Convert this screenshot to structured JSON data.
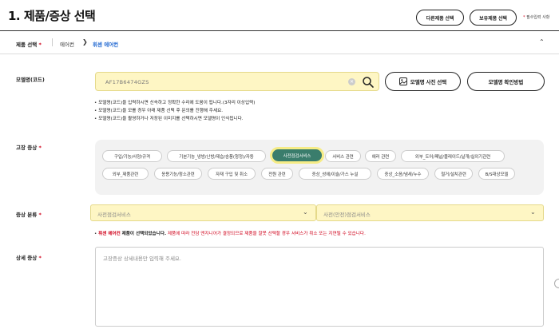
{
  "page": {
    "title": "1. 제품/증상 선택",
    "buttons": {
      "other_product": "다른제품 선택",
      "owned_product": "보유제품 선택"
    },
    "required_note": {
      "star": "*",
      "text": "필수입력 사항"
    }
  },
  "breadcrumb": {
    "label": "제품 선택",
    "star": "*",
    "items": [
      "에어컨",
      "휘센 에어컨"
    ]
  },
  "model": {
    "label": "모델명(코드)",
    "value": "AF17B6474GZS",
    "photo_button": "모델명 사진 선택",
    "howto_button": "모델명 확인방법",
    "tips": [
      "모델명(코드)을 입력하시면 신속하고 정확한 수리에 도움이 됩니다.(3자리 이상입력)",
      "모델명(코드)을 모를 경우 아래 제품 선택 후 문의를 진행해 주세요.",
      "모델명(코드)을 촬영하거나 저장된 이미지를 선택하시면 모델명이 인식됩니다."
    ]
  },
  "symptom": {
    "label": "고장 증상",
    "star": "*",
    "tags": [
      "구입/기능/사양/규격",
      "기본기능_냉방/난방/제습/송풍(청정)/자동",
      "사전점검서비스",
      "서비스 관련",
      "에러 관련",
      "외부_도어/패널/블레이드/날개/실외기관련",
      "외부_제품관련",
      "응용기능/청소관련",
      "자재 구입 및 취소",
      "전원 관련",
      "증상_성에/이슬/가스 누설",
      "증상_소음/냄새/누수",
      "철거/설치관련",
      "B/S대상모델"
    ],
    "selected": "사전점검서비스"
  },
  "category": {
    "label": "증상 분류",
    "star": "*",
    "select1": "사전점검서비스",
    "select2": "사전(안전)점검서비스",
    "note_bullet": "•",
    "note_product": "휘센 에어컨",
    "note_mid": "제품이 선택되었습니다.",
    "note_warning": "제품에 따라 전담 엔지니어가 결정되므로 제품을 잘못 선택할 경우 서비스가 취소 또는 지연될 수 있습니다."
  },
  "detail": {
    "label": "상세 증상",
    "star": "*",
    "placeholder": "고장증상 상세내용만 입력해 주세요."
  },
  "colors": {
    "highlight": "#fef6c4",
    "selected_tag": "#3a7d6c",
    "accent_blue": "#1e66d0",
    "warning_red": "#d0021b"
  }
}
